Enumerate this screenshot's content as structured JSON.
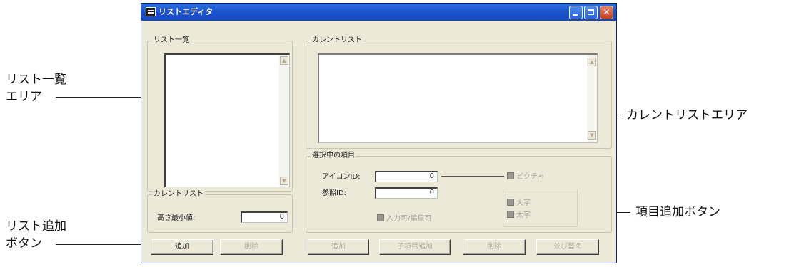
{
  "annotations": {
    "list_area": [
      "リスト一覧",
      "エリア"
    ],
    "add_list_button": [
      "リスト追加",
      "ボタン"
    ],
    "current_list_area": "カレントリストエリア",
    "add_item_button": "項目追加ボタン"
  },
  "window": {
    "title": "リストエディタ",
    "controls": {
      "minimize": "",
      "maximize": "",
      "close": "✕"
    }
  },
  "list_overview": {
    "label": "リスト一覧",
    "scroll_up": "▲",
    "scroll_down": "▼"
  },
  "current_list_group": {
    "label": "カレントリスト",
    "min_height_label": "高さ最小値:",
    "min_height_value": "0"
  },
  "current_list_area": {
    "label": "カレントリスト",
    "scroll_up": "▲",
    "scroll_down": "▼"
  },
  "selected_item": {
    "label": "選択中の項目",
    "icon_id_label": "アイコンID:",
    "icon_id_value": "0",
    "ref_id_label": "参照ID:",
    "ref_id_value": "0",
    "picture_checkbox": "ピクチャ",
    "large_checkbox": "大字",
    "bold_checkbox": "太字",
    "editable_checkbox": "入力可/編集可"
  },
  "buttons": {
    "add": "追加",
    "delete_list": "削除",
    "add_item": "追加",
    "add_sub_item": "子項目追加",
    "delete_item": "削除",
    "sort": "並び替え"
  }
}
